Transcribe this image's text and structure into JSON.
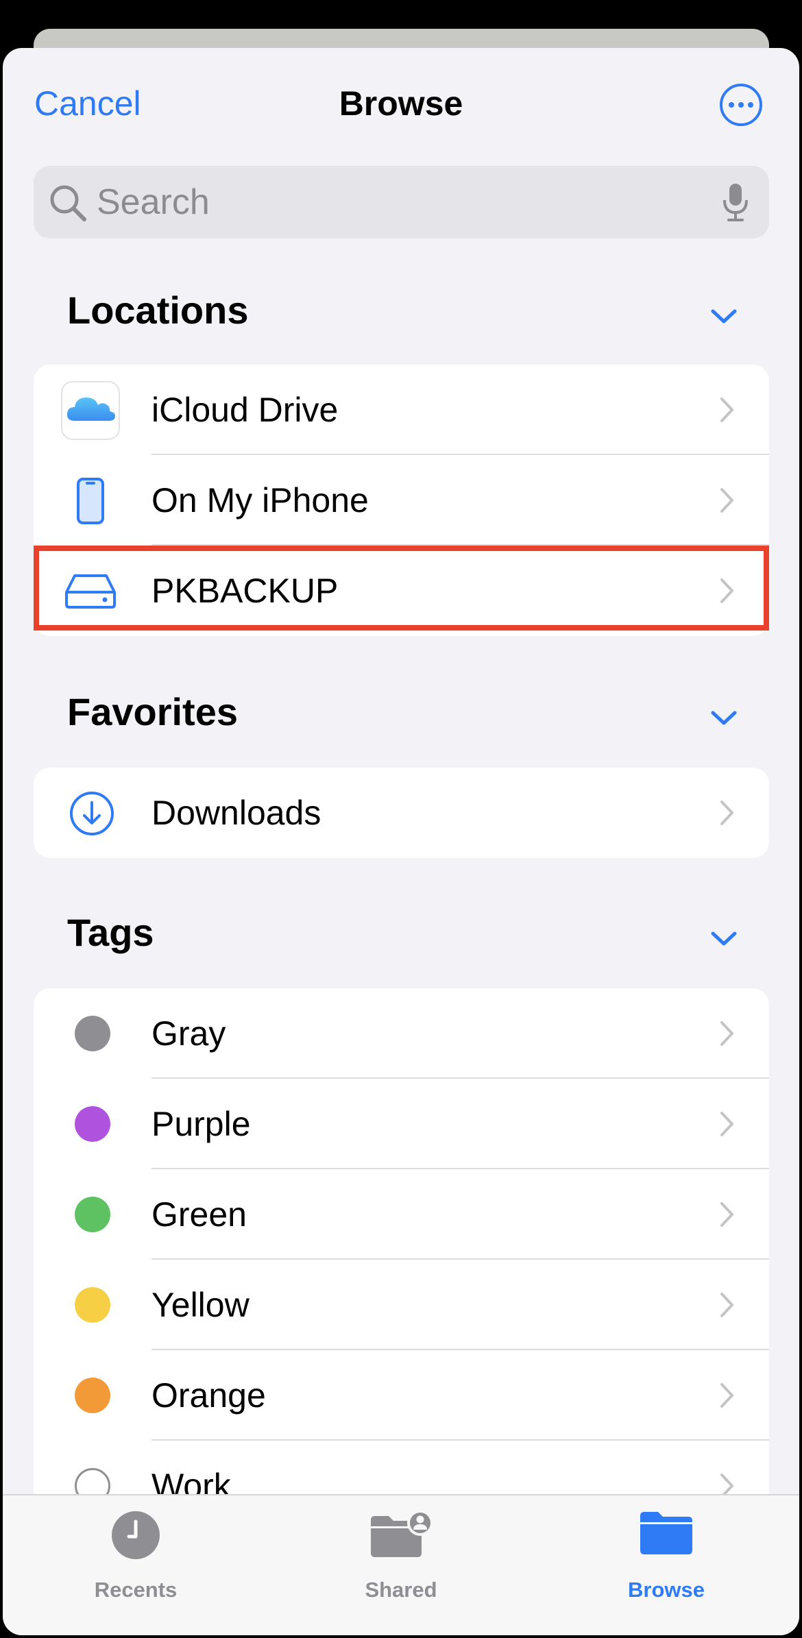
{
  "header": {
    "cancel_label": "Cancel",
    "title": "Browse"
  },
  "search": {
    "placeholder": "Search"
  },
  "locations": {
    "title": "Locations",
    "items": [
      {
        "label": "iCloud Drive",
        "icon": "icloud-icon"
      },
      {
        "label": "On My iPhone",
        "icon": "iphone-icon"
      },
      {
        "label": "PKBACKUP",
        "icon": "external-drive-icon"
      }
    ]
  },
  "favorites": {
    "title": "Favorites",
    "items": [
      {
        "label": "Downloads",
        "icon": "download-circle-icon"
      }
    ]
  },
  "tags": {
    "title": "Tags",
    "items": [
      {
        "label": "Gray",
        "color": "#8e8e93"
      },
      {
        "label": "Purple",
        "color": "#af52de"
      },
      {
        "label": "Green",
        "color": "#5ec162"
      },
      {
        "label": "Yellow",
        "color": "#f6cf45"
      },
      {
        "label": "Orange",
        "color": "#f29a37"
      },
      {
        "label": "Work",
        "color": "none"
      }
    ]
  },
  "tabbar": {
    "items": [
      {
        "label": "Recents",
        "icon": "clock-icon",
        "active": false
      },
      {
        "label": "Shared",
        "icon": "shared-folder-icon",
        "active": false
      },
      {
        "label": "Browse",
        "icon": "folder-icon",
        "active": true
      }
    ]
  },
  "colors": {
    "accent": "#2f7bf5",
    "highlight": "#e8412c",
    "inactive_tab": "#8e8e93"
  }
}
